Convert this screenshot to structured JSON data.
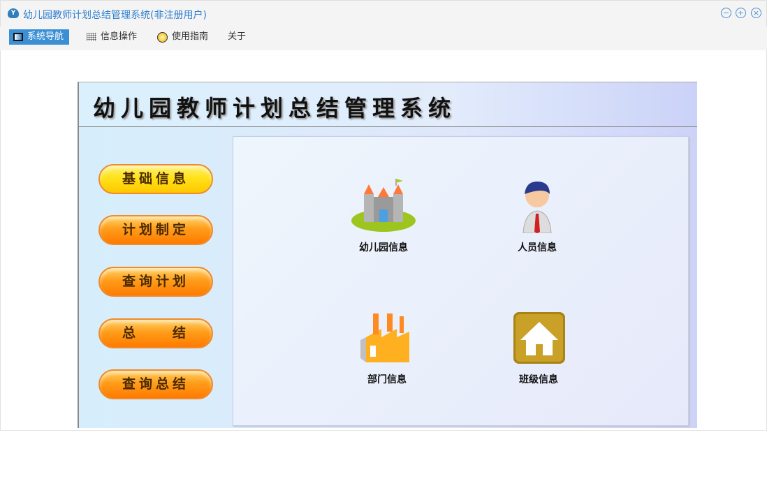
{
  "window": {
    "title": "幼儿园教师计划总结管理系统(非注册用户)",
    "app_icon_text": "Y"
  },
  "menu": [
    {
      "label": "系统导航"
    },
    {
      "label": "信息操作"
    },
    {
      "label": "使用指南"
    },
    {
      "label": "关于"
    }
  ],
  "header": {
    "title": "幼儿园教师计划总结管理系统"
  },
  "sidebar": [
    {
      "label": "基础信息"
    },
    {
      "label": "计划制定"
    },
    {
      "label": "查询计划"
    },
    {
      "label": "总　　结"
    },
    {
      "label": "查询总结"
    }
  ],
  "tiles": [
    {
      "label": "幼儿园信息",
      "icon": "castle-icon"
    },
    {
      "label": "人员信息",
      "icon": "person-icon"
    },
    {
      "label": "部门信息",
      "icon": "factory-icon"
    },
    {
      "label": "班级信息",
      "icon": "house-icon"
    }
  ],
  "colors": {
    "accent": "#3b8fd4",
    "title": "#2e7fd0",
    "button_orange": "#ff8a00",
    "button_yellow": "#ffe21a"
  }
}
